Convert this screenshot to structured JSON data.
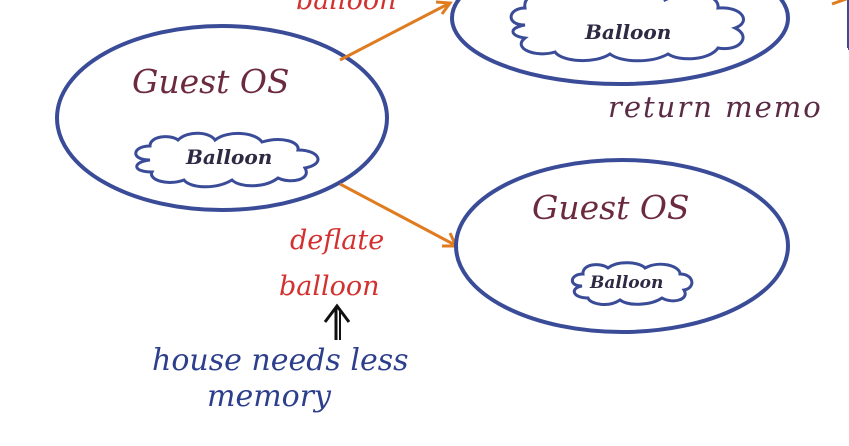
{
  "guest_os_label": "Guest OS",
  "balloon_label": "Balloon",
  "inflate_label_fragment": "balloon",
  "deflate_label_line1": "deflate",
  "deflate_label_line2": "balloon",
  "return_memory_label": "return memo",
  "host_note_line1": "house needs less",
  "host_note_line2": "memory",
  "colors": {
    "ellipse_stroke": "#3a4c98",
    "arrow": "#e07c20",
    "os_text": "#6b2a3e",
    "red_text": "#d3312f",
    "blue_text": "#2d3f8c",
    "purple_text": "#5b2a44"
  }
}
